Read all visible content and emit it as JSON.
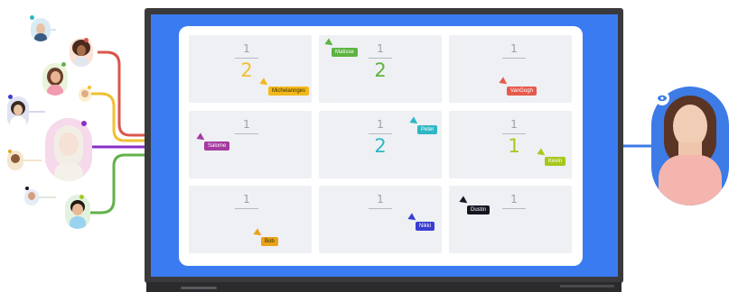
{
  "fractions": {
    "c1": {
      "num": "1",
      "den": "2"
    },
    "c2": {
      "num": "1",
      "den": "2"
    },
    "c3": {
      "num": "1",
      "den": ""
    },
    "c4": {
      "num": "1",
      "den": ""
    },
    "c5": {
      "num": "1",
      "den": "2"
    },
    "c6": {
      "num": "1",
      "den": "1"
    },
    "c7": {
      "num": "1",
      "den": ""
    },
    "c8": {
      "num": "1",
      "den": ""
    },
    "c9": {
      "num": "1",
      "den": ""
    }
  },
  "students": [
    {
      "name": "Michelannges",
      "color": "#f2b81c"
    },
    {
      "name": "Matisse",
      "color": "#5db341"
    },
    {
      "name": "VanGogh",
      "color": "#e65a4b"
    },
    {
      "name": "Salome",
      "color": "#a53aa0"
    },
    {
      "name": "Peter",
      "color": "#2fb7c6"
    },
    {
      "name": "Kevin",
      "color": "#a6c81d"
    },
    {
      "name": "Bob",
      "color": "#e9a21a"
    },
    {
      "name": "Nikki",
      "color": "#3a3ed0"
    },
    {
      "name": "Dustin",
      "color": "#161623"
    }
  ],
  "colors": {
    "screen_bg": "#3b7bf1",
    "wire_red": "#d9574a",
    "wire_yellow": "#f0c033",
    "wire_purple": "#8b2fc7",
    "wire_green": "#62b24a",
    "wire_blue": "#3d7be6"
  },
  "icons": {
    "teacher_badge": "eye-icon"
  }
}
